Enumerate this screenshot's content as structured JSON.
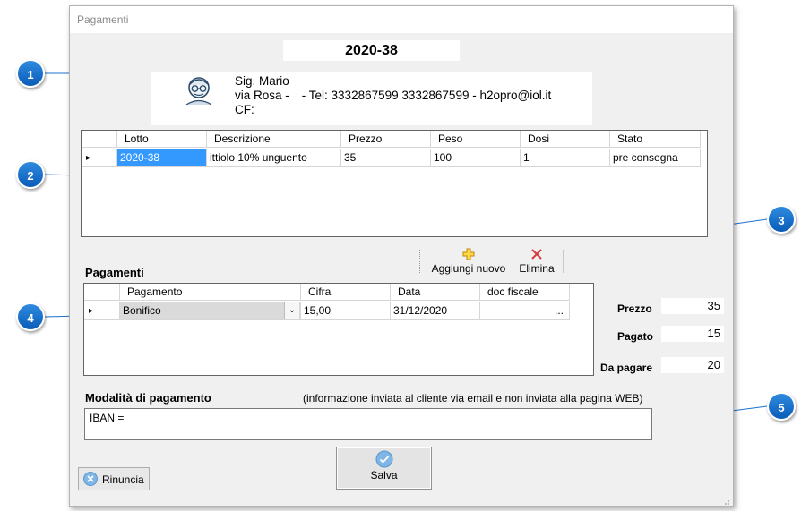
{
  "window": {
    "title": "Pagamenti"
  },
  "lotto_code": "2020-38",
  "client": {
    "line1": "Sig. Mario",
    "line2": "via Rosa -",
    "line2_contact": "- Tel: 3332867599 3332867599 - h2opro@iol.it",
    "line3": "CF:"
  },
  "lots_table": {
    "columns": [
      "Lotto",
      "Descrizione",
      "Prezzo",
      "Peso",
      "Dosi",
      "Stato"
    ],
    "rows": [
      {
        "marker": "▸",
        "cells": [
          "2020-38",
          "ittiolo 10% unguento",
          "35",
          "100",
          "1",
          "pre consegna"
        ]
      }
    ]
  },
  "toolbar": {
    "add_label": "Aggiungi nuovo",
    "delete_label": "Elimina"
  },
  "payments": {
    "title": "Pagamenti",
    "columns": [
      "Pagamento",
      "Cifra",
      "Data",
      "doc fiscale"
    ],
    "rows": [
      {
        "marker": "▸",
        "method": "Bonifico",
        "amount": "15,00",
        "date": "31/12/2020",
        "doc": "..."
      }
    ]
  },
  "totals": {
    "prezzo_label": "Prezzo",
    "prezzo_value": "35",
    "pagato_label": "Pagato",
    "pagato_value": "15",
    "da_pagare_label": "Da pagare",
    "da_pagare_value": "20"
  },
  "payment_mode": {
    "title": "Modalità di pagamento",
    "note": "(informazione inviata al cliente via email e non inviata alla pagina WEB)",
    "text": "IBAN ="
  },
  "buttons": {
    "save_label": "Salva",
    "cancel_label": "Rinuncia"
  },
  "callouts": [
    "1",
    "2",
    "3",
    "4",
    "5"
  ],
  "colors": {
    "accent": "#0a5cb8",
    "selection": "#3399ff",
    "add_icon": "#e8b400",
    "delete_icon": "#d83b3b"
  }
}
